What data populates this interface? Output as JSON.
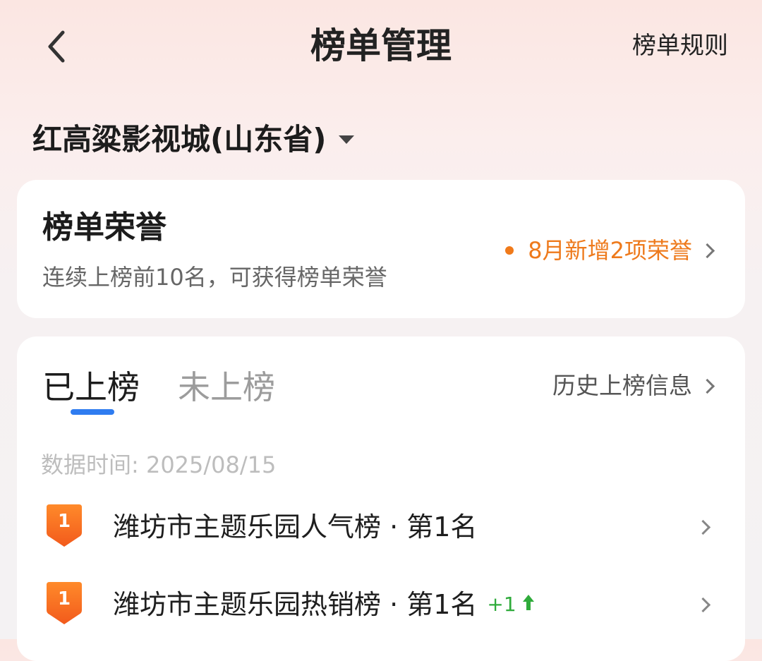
{
  "header": {
    "title": "榜单管理",
    "rules_link": "榜单规则",
    "back_icon": "chevron-left-icon"
  },
  "location": {
    "name": "红高粱影视城(山东省)",
    "caret_icon": "caret-down-icon"
  },
  "honor": {
    "title": "榜单荣誉",
    "subtitle": "连续上榜前10名，可获得榜单荣誉",
    "new_notice": "8月新增2项荣誉",
    "notice_color": "#ee7a1c"
  },
  "ranking": {
    "tabs": [
      {
        "label": "已上榜",
        "active": true
      },
      {
        "label": "未上榜",
        "active": false
      }
    ],
    "history_link": "历史上榜信息",
    "data_time": "数据时间: 2025/08/15",
    "accent_color": "#2f7cf0",
    "items": [
      {
        "badge": "1",
        "text": "潍坊市主题乐园人气榜 · 第1名",
        "change": ""
      },
      {
        "badge": "1",
        "text": "潍坊市主题乐园热销榜 · 第1名",
        "change": "+1"
      }
    ]
  }
}
